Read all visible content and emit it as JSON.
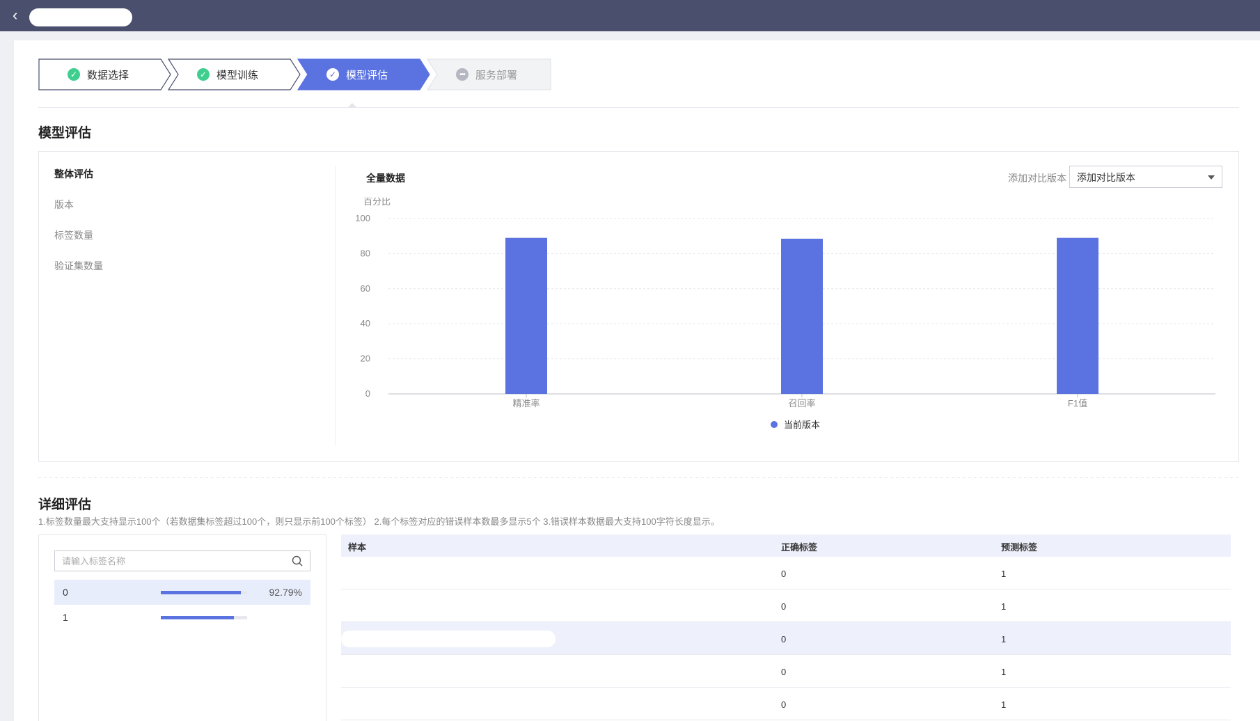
{
  "steps": [
    {
      "label": "数据选择",
      "status": "done"
    },
    {
      "label": "模型训练",
      "status": "done"
    },
    {
      "label": "模型评估",
      "status": "active"
    },
    {
      "label": "服务部署",
      "status": "todo"
    }
  ],
  "evaluation": {
    "section_title": "模型评估",
    "overall": {
      "heading": "整体评估",
      "fields": [
        "版本",
        "标签数量",
        "验证集数量"
      ]
    },
    "chart_title": "全量数据",
    "compare_label": "添加对比版本",
    "compare_select_value": "添加对比版本"
  },
  "chart_data": {
    "type": "bar",
    "ylabel": "百分比",
    "ylim": [
      0,
      100
    ],
    "yticks": [
      0,
      20,
      40,
      60,
      80,
      100
    ],
    "categories": [
      "精准率",
      "召回率",
      "F1值"
    ],
    "series": [
      {
        "name": "当前版本",
        "values": [
          89,
          88.5,
          89
        ],
        "color": "#5b73e0"
      }
    ],
    "grid": true,
    "legend_position": "bottom-center"
  },
  "detail": {
    "section_title": "详细评估",
    "note": "1.标签数量最大支持显示100个（若数据集标签超过100个，则只显示前100个标签） 2.每个标签对应的错误样本数最多显示5个 3.错误样本数据最大支持100字符长度显示。",
    "search_placeholder": "请输入标签名称",
    "labels": [
      {
        "name": "0",
        "fraction": 0.93,
        "percent_text": "92.79%",
        "selected": true
      },
      {
        "name": "1",
        "fraction": 0.85,
        "percent_text": "",
        "selected": false
      }
    ],
    "table": {
      "headers": [
        "样本",
        "正确标签",
        "预测标签"
      ],
      "rows": [
        {
          "sample": "",
          "correct": "0",
          "predicted": "1"
        },
        {
          "sample": "",
          "correct": "0",
          "predicted": "1"
        },
        {
          "sample": "",
          "correct": "0",
          "predicted": "1"
        },
        {
          "sample": "",
          "correct": "0",
          "predicted": "1"
        },
        {
          "sample": "",
          "correct": "0",
          "predicted": "1"
        }
      ]
    }
  }
}
